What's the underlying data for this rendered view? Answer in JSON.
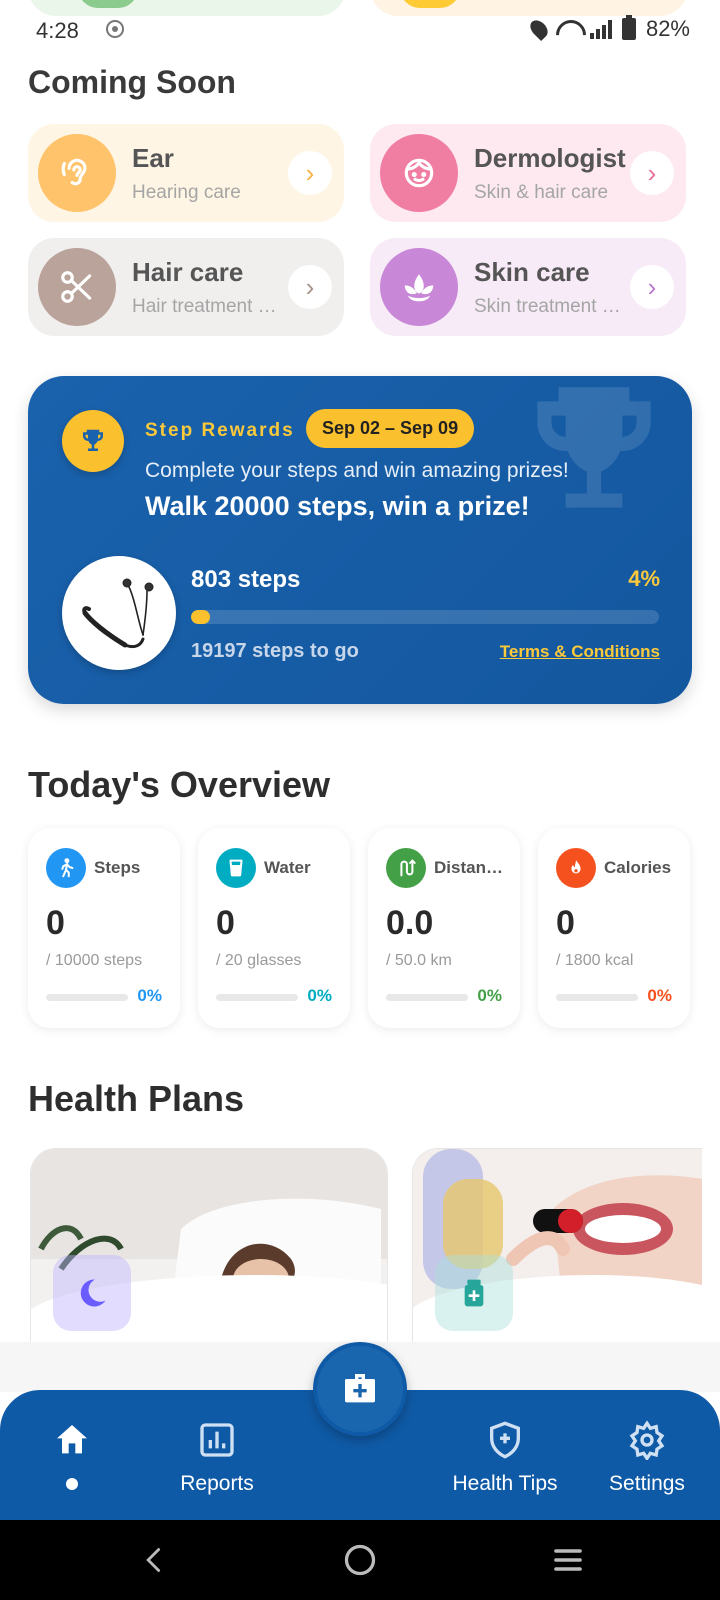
{
  "status_bar": {
    "time": "4:28",
    "battery": "82%"
  },
  "coming_soon": {
    "title": "Coming Soon",
    "items": [
      {
        "title": "Ear",
        "subtitle": "Hearing care",
        "icon": "ear-icon",
        "bg": "#fff5e4",
        "circle": "#ffc36b",
        "arrow": "#f5b34a"
      },
      {
        "title": "Dermologist",
        "subtitle": "Skin & hair care",
        "icon": "face-icon",
        "bg": "#fde9ef",
        "circle": "#f07ea3",
        "arrow": "#e8709a"
      },
      {
        "title": "Hair care",
        "subtitle": "Hair treatment …",
        "icon": "scissors-icon",
        "bg": "#f1efee",
        "circle": "#b9a39a",
        "arrow": "#a9938a"
      },
      {
        "title": "Skin care",
        "subtitle": "Skin treatment …",
        "icon": "lotus-icon",
        "bg": "#f7ebf7",
        "circle": "#c987d8",
        "arrow": "#bb78cc"
      }
    ]
  },
  "step_rewards": {
    "label": "Step Rewards",
    "dates": "Sep 02 – Sep 09",
    "description": "Complete your steps and win amazing prizes!",
    "headline": "Walk 20000 steps, win a prize!",
    "steps": "803 steps",
    "percent": "4%",
    "progress": 0.04,
    "to_go": "19197 steps to go",
    "terms": "Terms & Conditions"
  },
  "overview": {
    "title": "Today's Overview",
    "cards": [
      {
        "title": "Steps",
        "value": "0",
        "goal": "/ 10000 steps",
        "pct": "0%",
        "color": "#2196f3",
        "icon": "walk-icon"
      },
      {
        "title": "Water",
        "value": "0",
        "goal": "/ 20 glasses",
        "pct": "0%",
        "color": "#00acc1",
        "icon": "glass-icon"
      },
      {
        "title": "Distan…",
        "value": "0.0",
        "goal": "/ 50.0 km",
        "pct": "0%",
        "color": "#43a047",
        "icon": "route-icon"
      },
      {
        "title": "Calories",
        "value": "0",
        "goal": "/ 1800 kcal",
        "pct": "0%",
        "color": "#f4511e",
        "icon": "flame-icon"
      }
    ]
  },
  "health_plans": {
    "title": "Health Plans"
  },
  "bottom_nav": {
    "reports": "Reports",
    "health_tips": "Health Tips",
    "settings": "Settings"
  }
}
